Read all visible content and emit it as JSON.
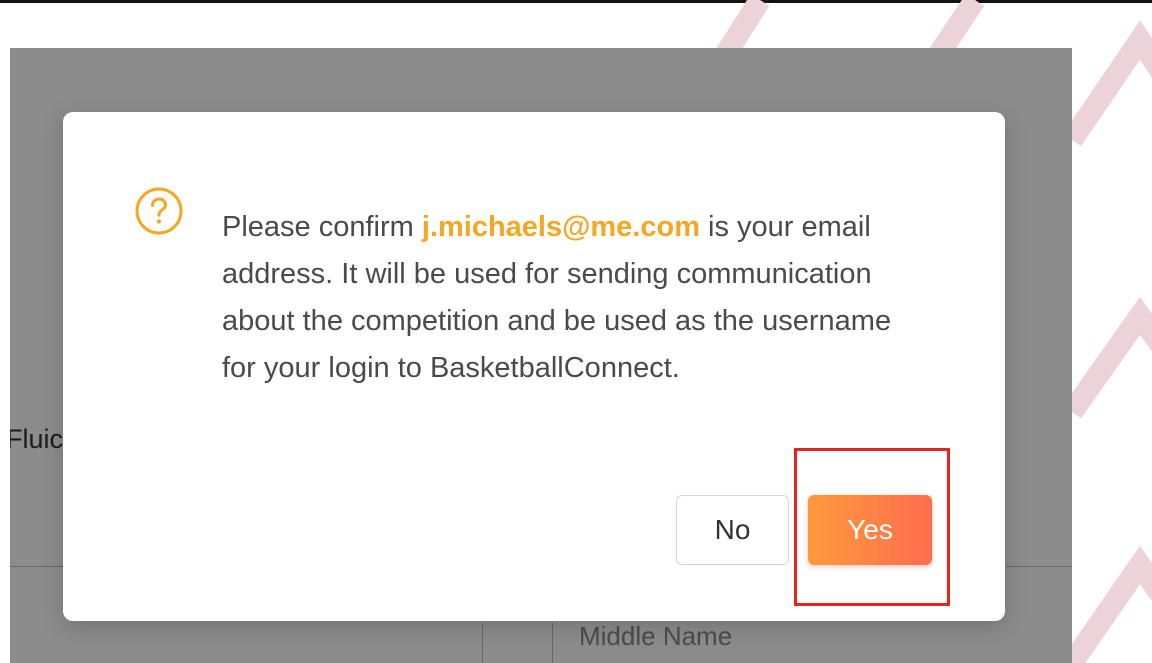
{
  "background_page": {
    "partial_label": "Fluic",
    "middle_name_placeholder": "Middle Name"
  },
  "dialog": {
    "icon": "question-circle-icon",
    "message_prefix": "Please confirm ",
    "email": "j.michaels@me.com",
    "message_suffix": " is your email address. It will be used for sending communication about the competition and be used as the username for your login to BasketballConnect.",
    "no_label": "No",
    "yes_label": "Yes"
  },
  "colors": {
    "accent_orange": "#f5a623",
    "yes_gradient_start": "#ff9a3c",
    "yes_gradient_end": "#ff6d4e",
    "annotation_red": "#e6231c",
    "overlay": "rgba(0,0,0,0.45)"
  }
}
